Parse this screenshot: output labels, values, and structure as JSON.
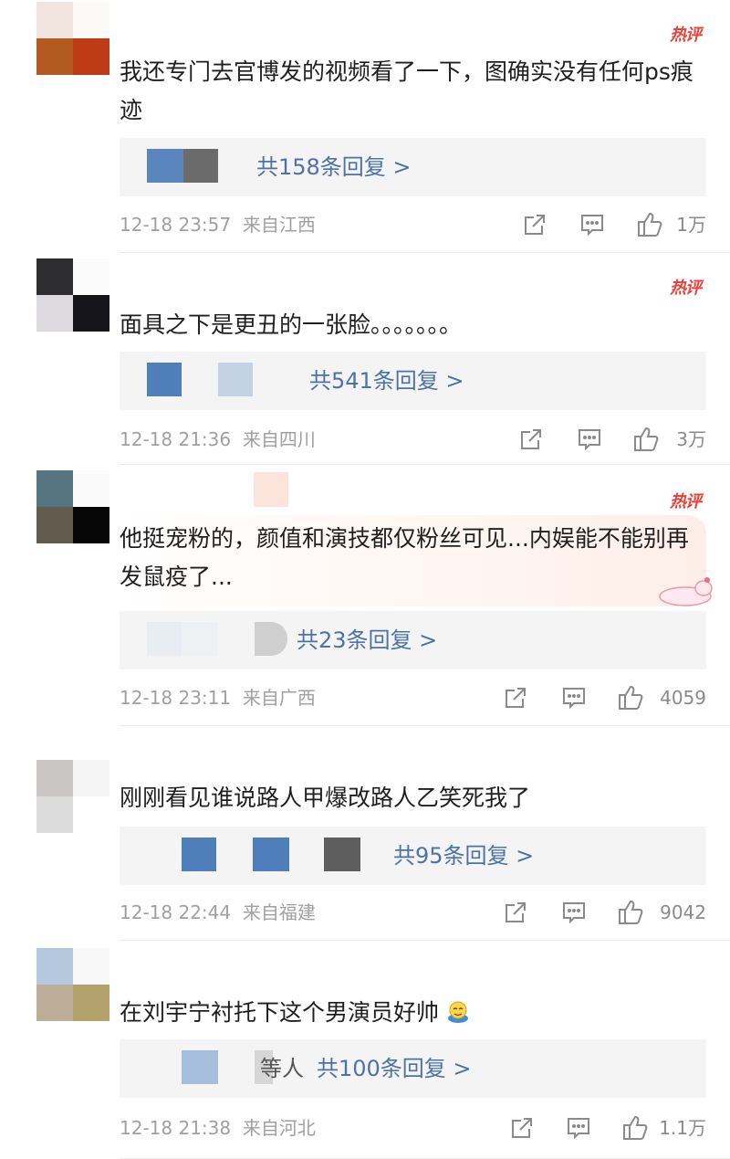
{
  "hot_badge": "热评",
  "comments": [
    {
      "text": "我还专门去官博发的视频看了一下，图确实没有任何ps痕迹",
      "replies_prefix": "",
      "replies_label": "共158条回复 >",
      "time": "12-18 23:57",
      "location": "来自江西",
      "likes": "1万",
      "hot": true
    },
    {
      "text": "面具之下是更丑的一张脸。。。。。。。",
      "replies_prefix": "",
      "replies_label": "共541条回复 >",
      "time": "12-18 21:36",
      "location": "来自四川",
      "likes": "3万",
      "hot": true
    },
    {
      "text": "他挺宠粉的，颜值和演技都仅粉丝可见...内娱能不能别再发鼠疫了...",
      "replies_prefix": "",
      "replies_label": "共23条回复 >",
      "time": "12-18 23:11",
      "location": "来自广西",
      "likes": "4059",
      "hot": true
    },
    {
      "text": "刚刚看见谁说路人甲爆改路人乙笑死我了",
      "replies_prefix": "",
      "replies_label": "共95条回复 >",
      "time": "12-18 22:44",
      "location": "来自福建",
      "likes": "9042",
      "hot": false
    },
    {
      "text": "在刘宇宁衬托下这个男演员好帅",
      "replies_prefix": "等人",
      "replies_label": "共100条回复 >",
      "time": "12-18 21:38",
      "location": "来自河北",
      "likes": "1.1万",
      "hot": false
    }
  ],
  "icons": {
    "share": "share-icon",
    "comment": "comment-icon",
    "like": "thumbs-up-icon",
    "emoji": "emoji-icon"
  },
  "colors": {
    "hot_badge": "#e8413a",
    "reply_link": "#4c72a6",
    "meta_text": "#a0a0a0",
    "reply_box": "#f4f4f4"
  }
}
